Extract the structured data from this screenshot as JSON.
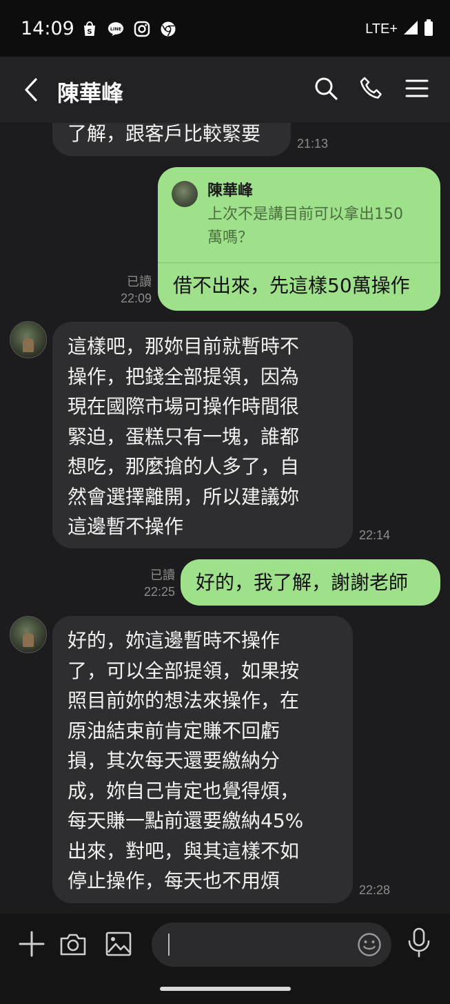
{
  "status_bar": {
    "time": "14:09",
    "network": "LTE+",
    "app_icons": [
      "shopee-icon",
      "line-icon",
      "instagram-icon",
      "chrome-icon"
    ]
  },
  "header": {
    "title": "陳華峰"
  },
  "messages": [
    {
      "direction": "incoming",
      "lines": [
        "了解，跟客戶比較緊要"
      ],
      "time": "21:13"
    },
    {
      "direction": "outgoing",
      "reply_to": {
        "author": "陳華峰",
        "lines": [
          "上次不是講目前可以拿出150",
          "萬嗎？"
        ]
      },
      "lines": [
        "借不出來，先這樣50萬操作"
      ],
      "read": "已讀",
      "time": "22:09"
    },
    {
      "direction": "incoming",
      "lines": [
        "這樣吧，那妳目前就暫時不",
        "操作，把錢全部提領，因為",
        "現在國際市場可操作時間很",
        "緊迫，蛋糕只有一塊，誰都",
        "想吃，那麼搶的人多了，自",
        "然會選擇離開，所以建議妳",
        "這邊暫不操作"
      ],
      "time": "22:14"
    },
    {
      "direction": "outgoing",
      "lines": [
        "好的，我了解，謝謝老師"
      ],
      "read": "已讀",
      "time": "22:25"
    },
    {
      "direction": "incoming",
      "lines": [
        "好的，妳這邊暫時不操作",
        "了，可以全部提領，如果按",
        "照目前妳的想法來操作，在",
        "原油結束前肯定賺不回虧",
        "損，其次每天還要繳納分",
        "成，妳自己肯定也覺得煩，",
        "每天賺一點前還要繳納45%",
        "出來，對吧，與其這樣不如",
        "停止操作，每天也不用煩"
      ],
      "time": "22:28"
    }
  ],
  "colors": {
    "outgoing_bubble": "#9fe08a",
    "incoming_bubble": "#2e2e30",
    "background": "#1c1c1e"
  }
}
